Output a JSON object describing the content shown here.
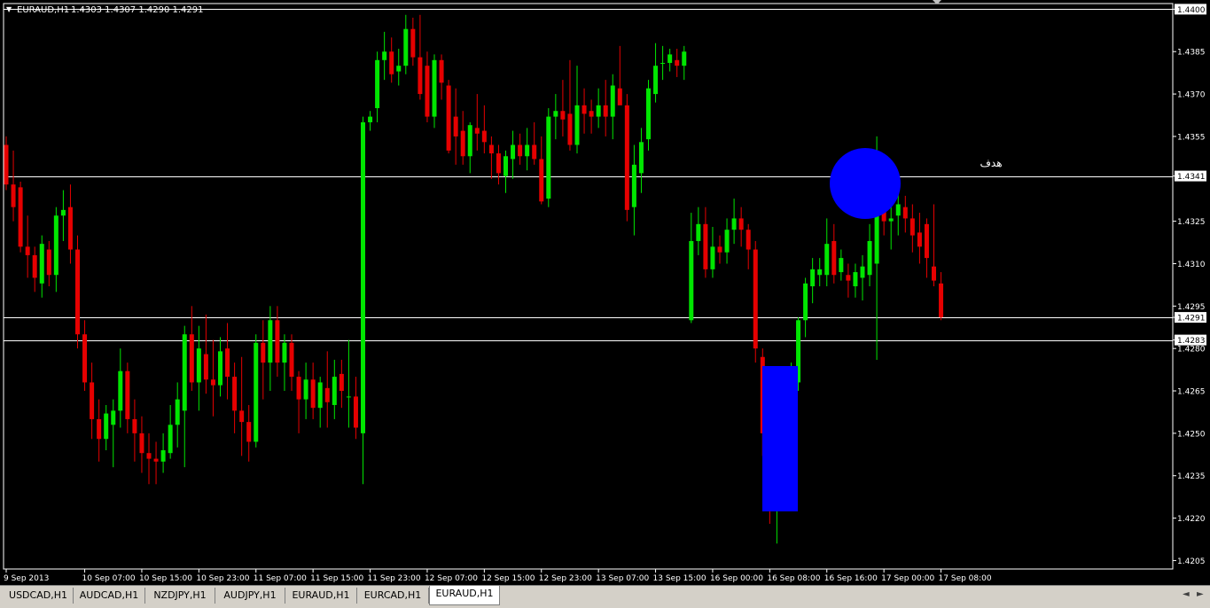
{
  "header": {
    "symbol": "EURAUD,H1",
    "ohlc": "1.4303 1.4307 1.4290 1.4291"
  },
  "annotation_text": "هدف",
  "tabs": [
    "USDCAD,H1",
    "AUDCAD,H1",
    "NZDJPY,H1",
    "AUDJPY,H1",
    "EURAUD,H1",
    "EURCAD,H1",
    "EURAUD,H1"
  ],
  "active_tab_index": 6,
  "colors": {
    "background": "#000000",
    "bull": "#00e600",
    "bear": "#e60000",
    "axis": "#ffffff",
    "hline": "#ffffff",
    "highlight": "#0000ff"
  },
  "chart_data": {
    "type": "candlestick",
    "symbol": "EURAUD",
    "timeframe": "H1",
    "ylim": [
      1.4202,
      1.4402
    ],
    "y_ticks": [
      "1.4400",
      "1.4385",
      "1.4370",
      "1.4355",
      "1.4341",
      "1.4325",
      "1.4310",
      "1.4295",
      "1.4291",
      "1.4283",
      "1.4280",
      "1.4265",
      "1.4250",
      "1.4235",
      "1.4220",
      "1.4205"
    ],
    "highlighted_ticks": [
      "1.4400",
      "1.4341",
      "1.4291",
      "1.4283"
    ],
    "horizontal_lines": [
      1.44,
      1.4341,
      1.4291,
      1.4283
    ],
    "x_labels": [
      {
        "label": "9 Sep 2013",
        "index": 0
      },
      {
        "label": "10 Sep 07:00",
        "index": 11
      },
      {
        "label": "10 Sep 15:00",
        "index": 19
      },
      {
        "label": "10 Sep 23:00",
        "index": 27
      },
      {
        "label": "11 Sep 07:00",
        "index": 35
      },
      {
        "label": "11 Sep 15:00",
        "index": 43
      },
      {
        "label": "11 Sep 23:00",
        "index": 51
      },
      {
        "label": "12 Sep 07:00",
        "index": 59
      },
      {
        "label": "12 Sep 15:00",
        "index": 67
      },
      {
        "label": "12 Sep 23:00",
        "index": 75
      },
      {
        "label": "13 Sep 07:00",
        "index": 83
      },
      {
        "label": "13 Sep 15:00",
        "index": 91
      },
      {
        "label": "16 Sep 00:00",
        "index": 99
      },
      {
        "label": "16 Sep 08:00",
        "index": 107
      },
      {
        "label": "16 Sep 16:00",
        "index": 115
      },
      {
        "label": "17 Sep 00:00",
        "index": 123
      },
      {
        "label": "17 Sep 08:00",
        "index": 131
      }
    ],
    "candles": [
      [
        1.4352,
        1.4355,
        1.4336,
        1.4338
      ],
      [
        1.4338,
        1.435,
        1.4325,
        1.433
      ],
      [
        1.4337,
        1.4339,
        1.4314,
        1.4316
      ],
      [
        1.4316,
        1.4327,
        1.4305,
        1.4313
      ],
      [
        1.4313,
        1.4316,
        1.43,
        1.4305
      ],
      [
        1.4303,
        1.432,
        1.4298,
        1.4317
      ],
      [
        1.4315,
        1.4318,
        1.4302,
        1.4306
      ],
      [
        1.4306,
        1.433,
        1.43,
        1.4327
      ],
      [
        1.4327,
        1.4336,
        1.4318,
        1.4329
      ],
      [
        1.433,
        1.4338,
        1.431,
        1.4315
      ],
      [
        1.4315,
        1.432,
        1.428,
        1.4285
      ],
      [
        1.4285,
        1.429,
        1.4265,
        1.4268
      ],
      [
        1.4268,
        1.4275,
        1.4248,
        1.4255
      ],
      [
        1.4255,
        1.4262,
        1.424,
        1.4248
      ],
      [
        1.4248,
        1.426,
        1.4244,
        1.4257
      ],
      [
        1.4253,
        1.4262,
        1.4238,
        1.4258
      ],
      [
        1.4258,
        1.428,
        1.4252,
        1.4272
      ],
      [
        1.4272,
        1.4275,
        1.425,
        1.4255
      ],
      [
        1.4255,
        1.4262,
        1.424,
        1.425
      ],
      [
        1.425,
        1.4256,
        1.4236,
        1.4243
      ],
      [
        1.4243,
        1.425,
        1.4232,
        1.4241
      ],
      [
        1.4241,
        1.4247,
        1.4232,
        1.424
      ],
      [
        1.424,
        1.425,
        1.4236,
        1.4244
      ],
      [
        1.4243,
        1.426,
        1.4241,
        1.4253
      ],
      [
        1.4253,
        1.4268,
        1.4245,
        1.4262
      ],
      [
        1.4258,
        1.4288,
        1.4238,
        1.4285
      ],
      [
        1.4285,
        1.4295,
        1.4265,
        1.4268
      ],
      [
        1.4268,
        1.4288,
        1.4258,
        1.428
      ],
      [
        1.4278,
        1.4292,
        1.4264,
        1.4269
      ],
      [
        1.4269,
        1.4283,
        1.4256,
        1.4267
      ],
      [
        1.4267,
        1.4284,
        1.4263,
        1.4279
      ],
      [
        1.428,
        1.4289,
        1.4262,
        1.427
      ],
      [
        1.427,
        1.4275,
        1.425,
        1.4258
      ],
      [
        1.4258,
        1.4277,
        1.4242,
        1.4254
      ],
      [
        1.4254,
        1.426,
        1.424,
        1.4247
      ],
      [
        1.4247,
        1.4285,
        1.4245,
        1.4282
      ],
      [
        1.4282,
        1.429,
        1.4262,
        1.4275
      ],
      [
        1.4275,
        1.4295,
        1.4265,
        1.429
      ],
      [
        1.429,
        1.4295,
        1.427,
        1.4275
      ],
      [
        1.4275,
        1.4285,
        1.4265,
        1.4282
      ],
      [
        1.4282,
        1.4285,
        1.4265,
        1.427
      ],
      [
        1.427,
        1.4272,
        1.425,
        1.4262
      ],
      [
        1.4262,
        1.4275,
        1.4255,
        1.4269
      ],
      [
        1.4269,
        1.4275,
        1.4255,
        1.4259
      ],
      [
        1.4259,
        1.427,
        1.4252,
        1.4268
      ],
      [
        1.4266,
        1.4279,
        1.4252,
        1.4261
      ],
      [
        1.426,
        1.4276,
        1.4255,
        1.427
      ],
      [
        1.4271,
        1.4276,
        1.4259,
        1.4265
      ],
      [
        1.4263,
        1.4283,
        1.4252,
        1.4263
      ],
      [
        1.4263,
        1.427,
        1.4248,
        1.4252
      ],
      [
        1.425,
        1.4362,
        1.4232,
        1.436
      ],
      [
        1.436,
        1.4364,
        1.4357,
        1.4362
      ],
      [
        1.4365,
        1.4385,
        1.436,
        1.4382
      ],
      [
        1.4382,
        1.4392,
        1.4375,
        1.4385
      ],
      [
        1.4385,
        1.439,
        1.4374,
        1.4377
      ],
      [
        1.4378,
        1.4386,
        1.4373,
        1.438
      ],
      [
        1.438,
        1.4398,
        1.4377,
        1.4393
      ],
      [
        1.4393,
        1.4397,
        1.438,
        1.4383
      ],
      [
        1.4383,
        1.4398,
        1.4368,
        1.437
      ],
      [
        1.438,
        1.4385,
        1.436,
        1.4362
      ],
      [
        1.4362,
        1.4384,
        1.4358,
        1.4382
      ],
      [
        1.4382,
        1.4384,
        1.4368,
        1.4374
      ],
      [
        1.4373,
        1.4375,
        1.4349,
        1.435
      ],
      [
        1.4362,
        1.4372,
        1.4345,
        1.4355
      ],
      [
        1.4357,
        1.4364,
        1.4345,
        1.4348
      ],
      [
        1.4348,
        1.436,
        1.4342,
        1.4359
      ],
      [
        1.4358,
        1.437,
        1.435,
        1.4356
      ],
      [
        1.4357,
        1.4366,
        1.4349,
        1.4353
      ],
      [
        1.4352,
        1.4355,
        1.434,
        1.4349
      ],
      [
        1.4349,
        1.4352,
        1.4338,
        1.4342
      ],
      [
        1.4341,
        1.435,
        1.4335,
        1.4348
      ],
      [
        1.4347,
        1.4357,
        1.434,
        1.4352
      ],
      [
        1.4352,
        1.4356,
        1.4345,
        1.4348
      ],
      [
        1.4348,
        1.4358,
        1.4343,
        1.4352
      ],
      [
        1.4352,
        1.436,
        1.4345,
        1.4347
      ],
      [
        1.4347,
        1.4355,
        1.4331,
        1.4332
      ],
      [
        1.4333,
        1.4365,
        1.433,
        1.4362
      ],
      [
        1.4362,
        1.437,
        1.4354,
        1.4364
      ],
      [
        1.4364,
        1.4375,
        1.4355,
        1.4361
      ],
      [
        1.4363,
        1.4382,
        1.435,
        1.4352
      ],
      [
        1.4352,
        1.438,
        1.4349,
        1.4366
      ],
      [
        1.4366,
        1.4372,
        1.4356,
        1.4363
      ],
      [
        1.4364,
        1.4368,
        1.4356,
        1.4362
      ],
      [
        1.4362,
        1.4372,
        1.4358,
        1.4366
      ],
      [
        1.4366,
        1.4375,
        1.4355,
        1.4362
      ],
      [
        1.4362,
        1.4377,
        1.4354,
        1.4373
      ],
      [
        1.4372,
        1.4387,
        1.4367,
        1.4366
      ],
      [
        1.4366,
        1.437,
        1.4325,
        1.4329
      ],
      [
        1.433,
        1.4352,
        1.432,
        1.4345
      ],
      [
        1.4342,
        1.4358,
        1.4335,
        1.4353
      ],
      [
        1.4354,
        1.4375,
        1.435,
        1.4372
      ],
      [
        1.437,
        1.4388,
        1.4367,
        1.438
      ],
      [
        1.4381,
        1.4387,
        1.4375,
        1.4381
      ],
      [
        1.4381,
        1.4386,
        1.4378,
        1.4384
      ],
      [
        1.4382,
        1.4386,
        1.4376,
        1.438
      ],
      [
        1.438,
        1.4387,
        1.4375,
        1.4385
      ],
      [
        1.429,
        1.4328,
        1.4289,
        1.4318
      ],
      [
        1.4318,
        1.433,
        1.4313,
        1.4324
      ],
      [
        1.4324,
        1.433,
        1.4305,
        1.4308
      ],
      [
        1.4308,
        1.4323,
        1.4305,
        1.4316
      ],
      [
        1.4316,
        1.432,
        1.431,
        1.4314
      ],
      [
        1.4314,
        1.4326,
        1.431,
        1.4322
      ],
      [
        1.4322,
        1.4333,
        1.4317,
        1.4326
      ],
      [
        1.4326,
        1.433,
        1.4316,
        1.4322
      ],
      [
        1.4322,
        1.4324,
        1.4308,
        1.4315
      ],
      [
        1.4315,
        1.4318,
        1.4275,
        1.428
      ],
      [
        1.4277,
        1.428,
        1.4242,
        1.425
      ],
      [
        1.425,
        1.4262,
        1.4218,
        1.4223
      ],
      [
        1.4224,
        1.424,
        1.4211,
        1.4229
      ],
      [
        1.423,
        1.426,
        1.4226,
        1.4257
      ],
      [
        1.425,
        1.4275,
        1.424,
        1.427
      ],
      [
        1.4268,
        1.4291,
        1.4265,
        1.429
      ],
      [
        1.429,
        1.4305,
        1.4284,
        1.4303
      ],
      [
        1.4302,
        1.4312,
        1.4296,
        1.4308
      ],
      [
        1.4306,
        1.4312,
        1.4302,
        1.4308
      ],
      [
        1.4306,
        1.4326,
        1.4302,
        1.4317
      ],
      [
        1.4318,
        1.4324,
        1.4303,
        1.4306
      ],
      [
        1.4307,
        1.4315,
        1.4304,
        1.4312
      ],
      [
        1.4306,
        1.431,
        1.4298,
        1.4304
      ],
      [
        1.4302,
        1.431,
        1.4298,
        1.4307
      ],
      [
        1.4305,
        1.4313,
        1.4297,
        1.4309
      ],
      [
        1.4306,
        1.4324,
        1.4302,
        1.4318
      ],
      [
        1.431,
        1.4355,
        1.4276,
        1.434
      ],
      [
        1.434,
        1.4345,
        1.432,
        1.4325
      ],
      [
        1.4325,
        1.4334,
        1.4315,
        1.4326
      ],
      [
        1.4327,
        1.4335,
        1.432,
        1.4331
      ],
      [
        1.433,
        1.4334,
        1.4321,
        1.4326
      ],
      [
        1.4326,
        1.4331,
        1.4314,
        1.432
      ],
      [
        1.4321,
        1.4328,
        1.431,
        1.4316
      ],
      [
        1.4324,
        1.4326,
        1.4305,
        1.4312
      ],
      [
        1.4309,
        1.4331,
        1.4302,
        1.4304
      ],
      [
        1.4303,
        1.4307,
        1.429,
        1.4291
      ]
    ]
  }
}
